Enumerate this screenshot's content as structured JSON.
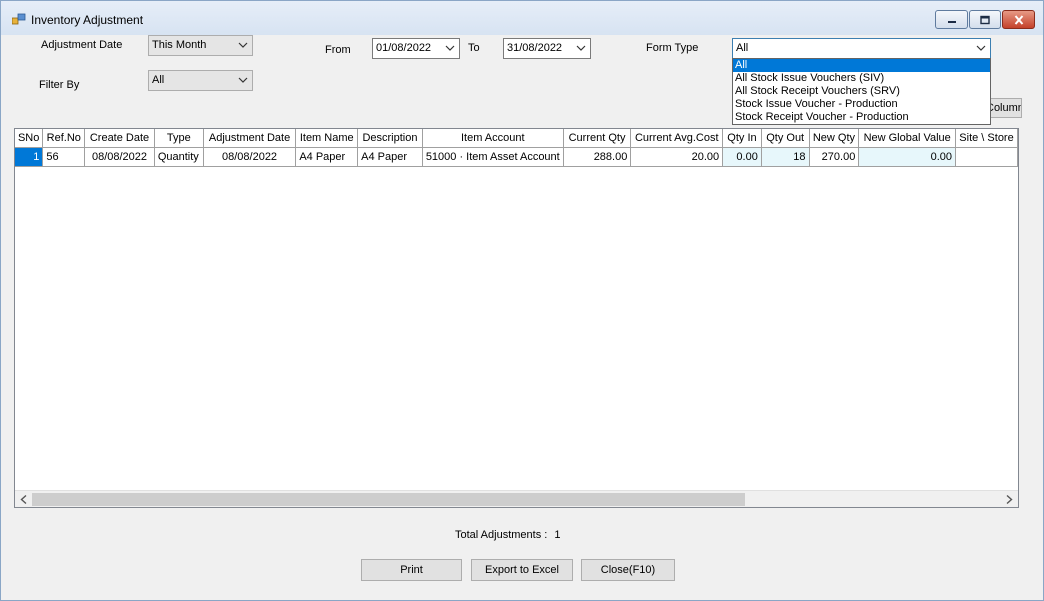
{
  "window": {
    "title": "Inventory Adjustment",
    "icon": "app-icon",
    "controls": [
      "minimize-icon",
      "maximize-icon",
      "close-icon"
    ]
  },
  "filters": {
    "adjustment_date_label": "Adjustment Date",
    "adjustment_date_value": "This Month",
    "filter_by_label": "Filter By",
    "filter_by_value": "All",
    "from_label": "From",
    "from_value": "01/08/2022",
    "to_label": "To",
    "to_value": "31/08/2022",
    "form_type_label": "Form Type",
    "form_type_value": "All",
    "form_type_options": [
      "All",
      "All Stock Issue Vouchers (SIV)",
      "All Stock Receipt Vouchers (SRV)",
      "Stock Issue Voucher - Production",
      "Stock Receipt Voucher - Production"
    ]
  },
  "columns_button_label": "Columns",
  "grid": {
    "headers": [
      "SNo",
      "Ref.No",
      "Create Date",
      "Type",
      "Adjustment Date",
      "Item Name",
      "Description",
      "Item Account",
      "Current Qty",
      "Current Avg.Cost",
      "Qty In",
      "Qty Out",
      "New Qty",
      "New Global Value",
      "Site \\ Store"
    ],
    "rows": [
      [
        "1",
        "56",
        "08/08/2022",
        "Quantity",
        "08/08/2022",
        "A4 Paper",
        "A4 Paper",
        "51000 · Item Asset Account",
        "288.00",
        "20.00",
        "0.00",
        "18",
        "270.00",
        "0.00",
        ""
      ]
    ],
    "scroll_left_icon": "chevron-left-icon",
    "scroll_right_icon": "chevron-right-icon"
  },
  "footer": {
    "total_label": "Total Adjustments :",
    "total_value": "1",
    "print_label": "Print",
    "export_label": "Export to Excel",
    "close_label": "Close(F10)"
  },
  "colors": {
    "selection": "#0078d7",
    "titlebar": "#dae5f3",
    "close_button": "#c4412a",
    "highlight_cell": "#e7f7fb"
  }
}
